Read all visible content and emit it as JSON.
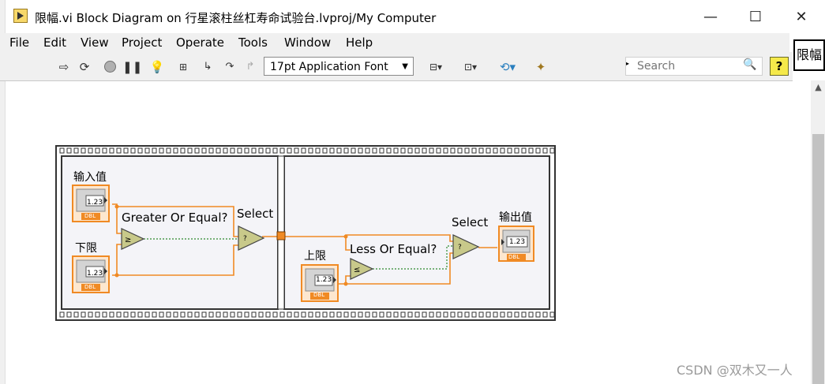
{
  "window": {
    "title": "限幅.vi Block Diagram on 行星滚柱丝杠寿命试验台.lvproj/My Computer",
    "minimize": "—",
    "maximize": "☐",
    "close": "✕"
  },
  "menu": [
    "File",
    "Edit",
    "View",
    "Project",
    "Operate",
    "Tools",
    "Window",
    "Help"
  ],
  "toolbar": {
    "font_select": "17pt Application Font",
    "search_placeholder": "Search",
    "help_label": "?"
  },
  "icon_pane": {
    "label": "限幅"
  },
  "diagram": {
    "frame1": {
      "input_label": "输入值",
      "lower_label": "下限",
      "compare_label": "Greater Or Equal?",
      "select_label": "Select",
      "indicator_value": "1.23",
      "type": "DBL"
    },
    "frame2": {
      "upper_label": "上限",
      "compare_label": "Less Or Equal?",
      "select_label": "Select",
      "output_label": "输出值",
      "indicator_value": "1.23",
      "type": "DBL"
    },
    "colors": {
      "numeric": "#f08a24",
      "boolean": "#2e8b2e",
      "frame": "#3a3a3a",
      "node": "#c8c98a"
    }
  },
  "watermark": "CSDN @双木又一人"
}
